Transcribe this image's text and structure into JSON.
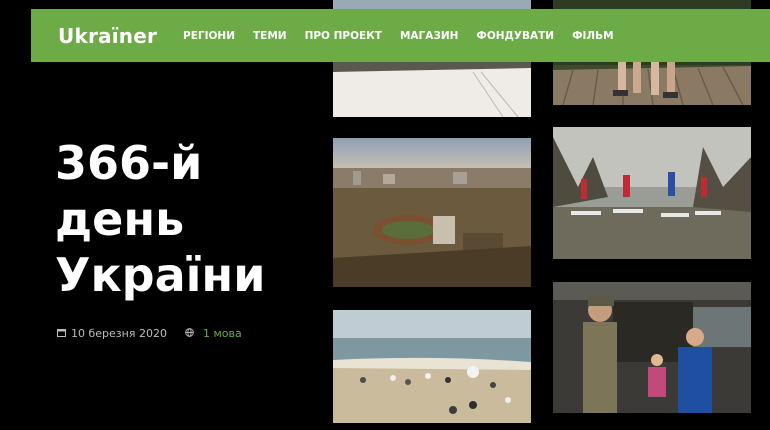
{
  "brand": {
    "logo": "Ukraïner"
  },
  "nav": {
    "items": [
      "РЕГІОНИ",
      "ТЕМИ",
      "ПРО ПРОЕКТ",
      "МАГАЗИН",
      "ФОНДУВАТИ",
      "ФІЛЬМ"
    ]
  },
  "article": {
    "title_lines": [
      "366-й",
      "день",
      "України"
    ],
    "date": "10 березня 2020",
    "languages": "1 мова"
  },
  "icons": {
    "calendar": "calendar-icon",
    "globe": "globe-icon"
  },
  "colors": {
    "accent": "#6cab46",
    "background": "#000000"
  }
}
